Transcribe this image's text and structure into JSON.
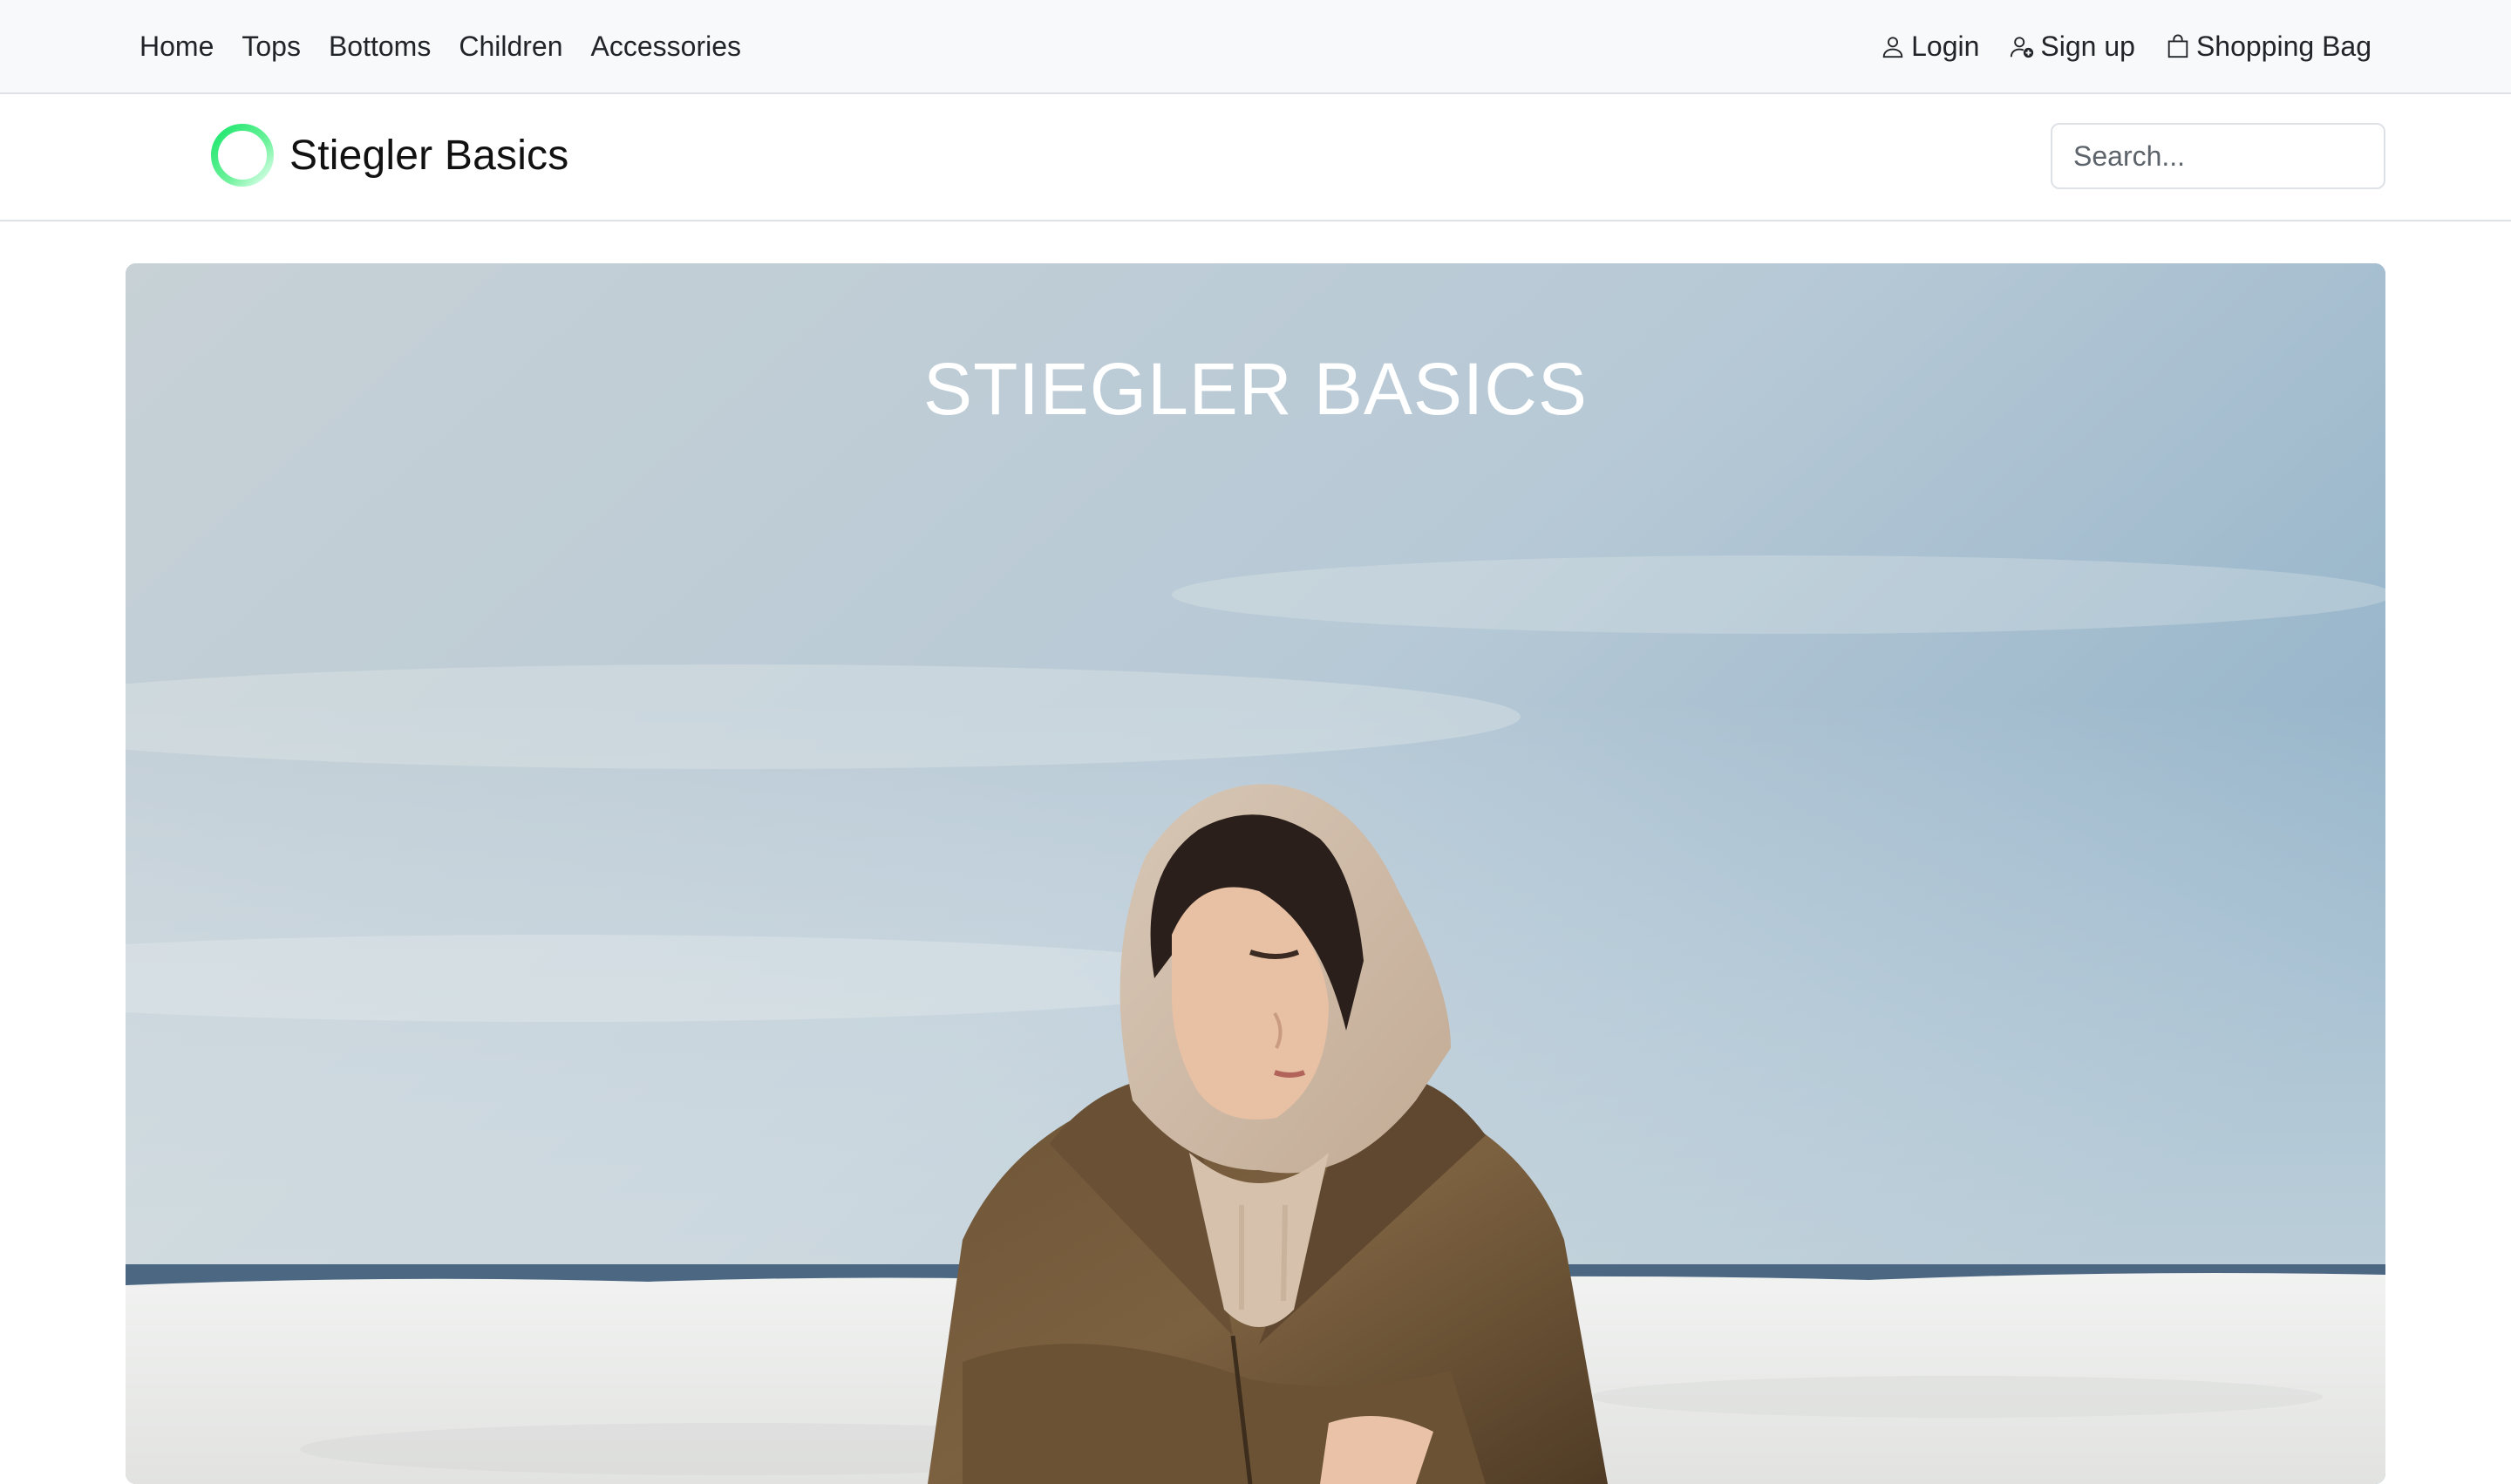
{
  "nav": {
    "links": [
      "Home",
      "Tops",
      "Bottoms",
      "Children",
      "Accessories"
    ],
    "login_label": "Login",
    "signup_label": "Sign up",
    "bag_label": "Shopping Bag"
  },
  "header": {
    "brand_name": "Stiegler Basics",
    "search_placeholder": "Search..."
  },
  "hero": {
    "title": "STIEGLER BASICS"
  },
  "colors": {
    "logo_gradient_start": "#19e66b",
    "logo_gradient_end": "#d7ffe4",
    "topbar_bg": "#f8f9fa",
    "border": "#dee2e6"
  },
  "icons": {
    "login": "person-icon",
    "signup": "person-plus-icon",
    "bag": "shopping-bag-icon",
    "logo": "ring-logo"
  }
}
